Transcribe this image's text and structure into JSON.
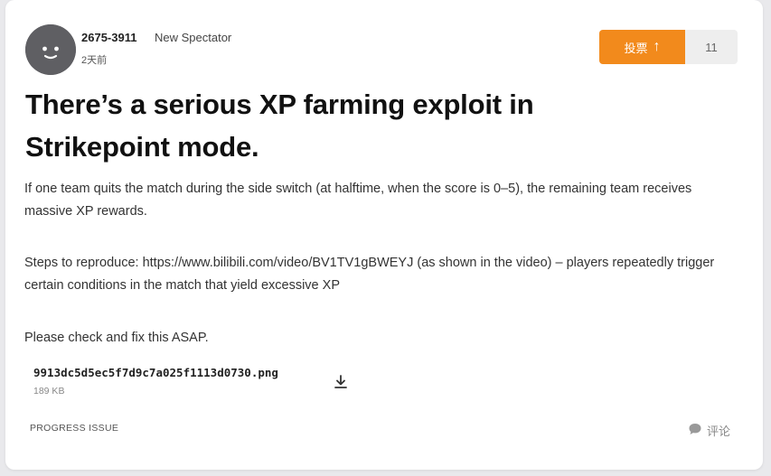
{
  "post": {
    "author": {
      "username": "2675-3911",
      "rank": "New Spectator",
      "time_ago": "2天前"
    },
    "vote": {
      "label": "投票",
      "icon": "arrow-up-icon",
      "count": "11"
    },
    "title": "There’s a serious XP farming exploit in Strikepoint mode.",
    "paragraphs": [
      "If one team quits the match during the side switch (at halftime, when the score is 0–5), the remaining team receives massive XP rewards.",
      "Steps to reproduce: https://www.bilibili.com/video/BV1TV1gBWEYJ (as shown in the video) – players repeatedly trigger certain conditions in the match that yield excessive XP",
      "Please check and fix this ASAP."
    ],
    "attachment": {
      "filename": "9913dc5d5ec5f7d9c7a025f1113d0730.png",
      "size": "189 KB",
      "icon": "download-icon"
    },
    "tag": "PROGRESS ISSUE",
    "comment": {
      "label": "评论",
      "icon": "comment-bubble-icon"
    }
  },
  "colors": {
    "accent": "#f28a1c",
    "avatar": "#5f5f63",
    "background": "#e9e9ec"
  }
}
